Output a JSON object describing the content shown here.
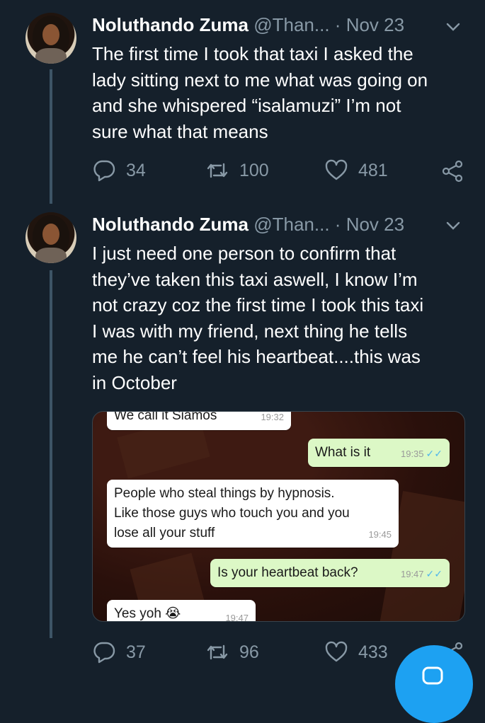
{
  "tweets": [
    {
      "name": "Noluthando Zuma",
      "handle": "@Than...",
      "dot": "·",
      "date": "Nov 23",
      "text_lines": [
        "The first time I took that taxi I asked the",
        "lady sitting next to me what was going on",
        "and she whispered “isalamuzi” I’m not",
        "sure what that means"
      ],
      "replies": "34",
      "retweets": "100",
      "likes": "481"
    },
    {
      "name": "Noluthando Zuma",
      "handle": "@Than...",
      "dot": "·",
      "date": "Nov 23",
      "text_lines": [
        "I just need one person to confirm that",
        "they’ve taken this taxi aswell, I know I’m",
        "not crazy coz the first time I took this taxi",
        "I was with my friend, next thing he tells",
        "me he can’t feel his heartbeat....this was",
        "in October"
      ],
      "replies": "37",
      "retweets": "96",
      "likes": "433"
    }
  ],
  "chat": {
    "top": {
      "text": "We call it Siamos",
      "time": "19:32"
    },
    "msg1": {
      "text": "What is it",
      "time": "19:35",
      "ticks": "✓✓"
    },
    "msg2": {
      "lines": [
        "People who steal things by hypnosis.",
        "Like those guys who touch you and you",
        "lose all your stuff"
      ],
      "time": "19:45"
    },
    "msg3": {
      "text": "Is your heartbeat back?",
      "time": "19:47",
      "ticks": "✓✓"
    },
    "msg4": {
      "text": "Yes yoh 😭",
      "time": "19:47"
    }
  },
  "icons": {
    "reply": "reply-icon",
    "retweet": "retweet-icon",
    "like": "heart-icon",
    "share": "share-icon",
    "compose": "compose-icon",
    "more": "chevron-down-icon"
  },
  "colors": {
    "background": "#15202b",
    "secondary_text": "#8899a6",
    "accent": "#1da1f2",
    "outgoing_bubble": "#dcf8c6",
    "incoming_bubble": "#ffffff"
  }
}
